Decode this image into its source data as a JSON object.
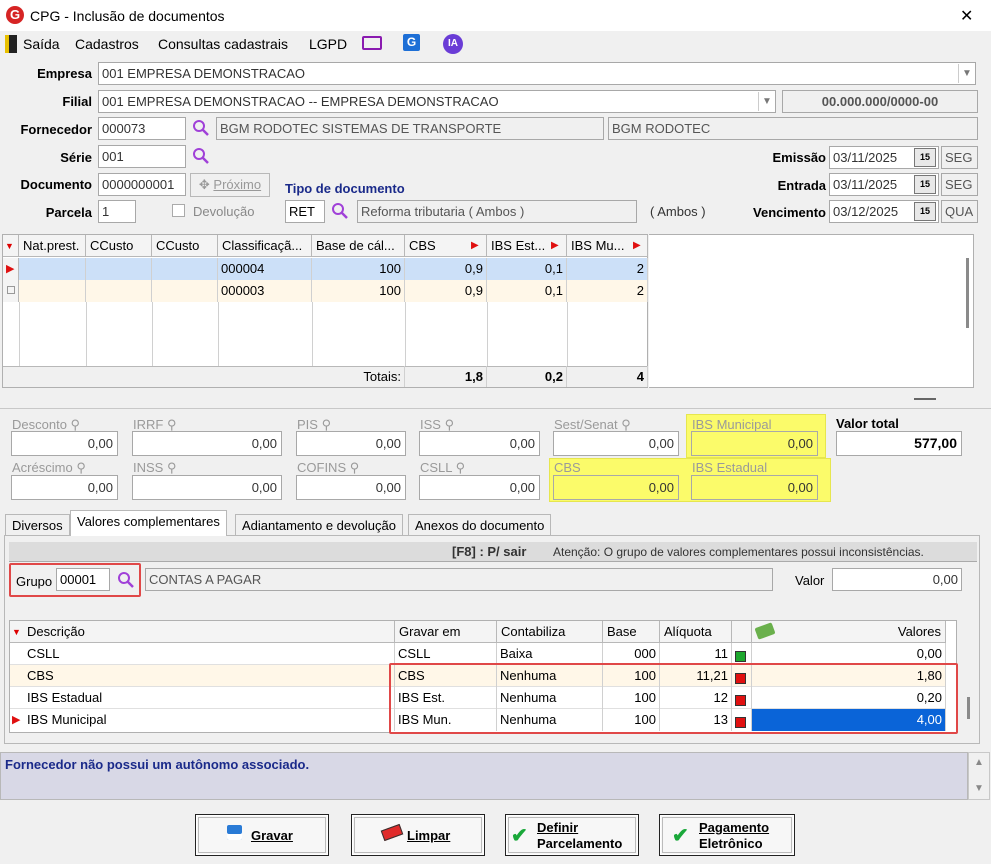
{
  "window": {
    "title": "CPG - Inclusão de documentos",
    "close": "✕"
  },
  "menu": {
    "saida": "Saída",
    "cadastros": "Cadastros",
    "consultas": "Consultas cadastrais",
    "lgpd": "LGPD",
    "ia": "IA"
  },
  "header": {
    "empresa_label": "Empresa",
    "empresa_value": "001 EMPRESA DEMONSTRACAO",
    "filial_label": "Filial",
    "filial_value": "001 EMPRESA DEMONSTRACAO -- EMPRESA DEMONSTRACAO",
    "cnpj": "00.000.000/0000-00",
    "fornecedor_label": "Fornecedor",
    "fornecedor_code": "000073",
    "fornecedor_name": "BGM RODOTEC SISTEMAS DE TRANSPORTE",
    "fornecedor_short": "BGM RODOTEC",
    "serie_label": "Série",
    "serie_value": "001",
    "documento_label": "Documento",
    "documento_value": "0000000001",
    "proximo_label": "Próximo",
    "tipo_doc_label": "Tipo de documento",
    "tipo_doc_code": "RET",
    "tipo_doc_desc": "Reforma tributaria ( Ambos )",
    "tipo_doc_extra": "( Ambos )",
    "parcela_label": "Parcela",
    "parcela_value": "1",
    "devolucao_label": "Devolução",
    "emissao_label": "Emissão",
    "emissao_value": "03/11/2025",
    "emissao_day": "SEG",
    "entrada_label": "Entrada",
    "entrada_value": "03/11/2025",
    "entrada_day": "SEG",
    "vencimento_label": "Vencimento",
    "vencimento_value": "03/12/2025",
    "vencimento_day": "QUA",
    "cal_icon": "15"
  },
  "items_grid": {
    "columns": [
      "Nat.prest.",
      "CCusto",
      "CCusto",
      "Classificaçã...",
      "Base de cál...",
      "CBS",
      "IBS Est...",
      "IBS Mu..."
    ],
    "rows": [
      [
        "",
        "",
        "",
        "000004",
        "100",
        "0,9",
        "0,1",
        "2"
      ],
      [
        "",
        "",
        "",
        "000003",
        "100",
        "0,9",
        "0,1",
        "2"
      ]
    ],
    "totals_label": "Totais:",
    "totals": [
      "1,8",
      "0,2",
      "4"
    ]
  },
  "totals_panel": {
    "desconto": {
      "label": "Desconto",
      "value": "0,00"
    },
    "irrf": {
      "label": "IRRF",
      "value": "0,00"
    },
    "pis": {
      "label": "PIS",
      "value": "0,00"
    },
    "iss": {
      "label": "ISS",
      "value": "0,00"
    },
    "sest": {
      "label": "Sest/Senat",
      "value": "0,00"
    },
    "ibs_mun": {
      "label": "IBS Municipal",
      "value": "0,00"
    },
    "valor_total": {
      "label": "Valor total",
      "value": "577,00"
    },
    "acrescimo": {
      "label": "Acréscimo",
      "value": "0,00"
    },
    "inss": {
      "label": "INSS",
      "value": "0,00"
    },
    "cofins": {
      "label": "COFINS",
      "value": "0,00"
    },
    "csll": {
      "label": "CSLL",
      "value": "0,00"
    },
    "cbs": {
      "label": "CBS",
      "value": "0,00"
    },
    "ibs_est": {
      "label": "IBS Estadual",
      "value": "0,00"
    }
  },
  "tabs": [
    "Diversos",
    "Valores complementares",
    "Adiantamento e devolução",
    "Anexos do documento"
  ],
  "compl": {
    "f8": "[F8] : P/ sair",
    "warning": "Atenção: O grupo de valores complementares possui inconsistências.",
    "grupo_label": "Grupo",
    "grupo_value": "00001",
    "grupo_desc": "CONTAS A PAGAR",
    "valor_label": "Valor",
    "valor_value": "0,00",
    "columns": [
      "Descrição",
      "Gravar em",
      "Contabiliza",
      "Base",
      "Alíquota",
      "",
      "Valores"
    ],
    "rows": [
      {
        "desc": "CSLL",
        "gravar": "CSLL",
        "contab": "Baixa",
        "base": "000",
        "aliq": "11",
        "status": "green",
        "valor": "0,00"
      },
      {
        "desc": "CBS",
        "gravar": "CBS",
        "contab": "Nenhuma",
        "base": "100",
        "aliq": "11,21",
        "status": "red",
        "valor": "1,80"
      },
      {
        "desc": "IBS Estadual",
        "gravar": "IBS Est.",
        "contab": "Nenhuma",
        "base": "100",
        "aliq": "12",
        "status": "red",
        "valor": "0,20"
      },
      {
        "desc": "IBS Municipal",
        "gravar": "IBS Mun.",
        "contab": "Nenhuma",
        "base": "100",
        "aliq": "13",
        "status": "red",
        "valor": "4,00"
      }
    ]
  },
  "status_message": "Fornecedor não possui um autônomo associado.",
  "buttons": {
    "gravar": "Gravar",
    "limpar": "Limpar",
    "definir1": "Definir",
    "definir2": "Parcelamento",
    "pag1": "Pagamento",
    "pag2": "Eletrônico"
  },
  "colors": {
    "accent": "#0a64d8",
    "highlight": "#fbfb6a",
    "annotation": "#e04848",
    "status_text": "#1a2a8a"
  }
}
